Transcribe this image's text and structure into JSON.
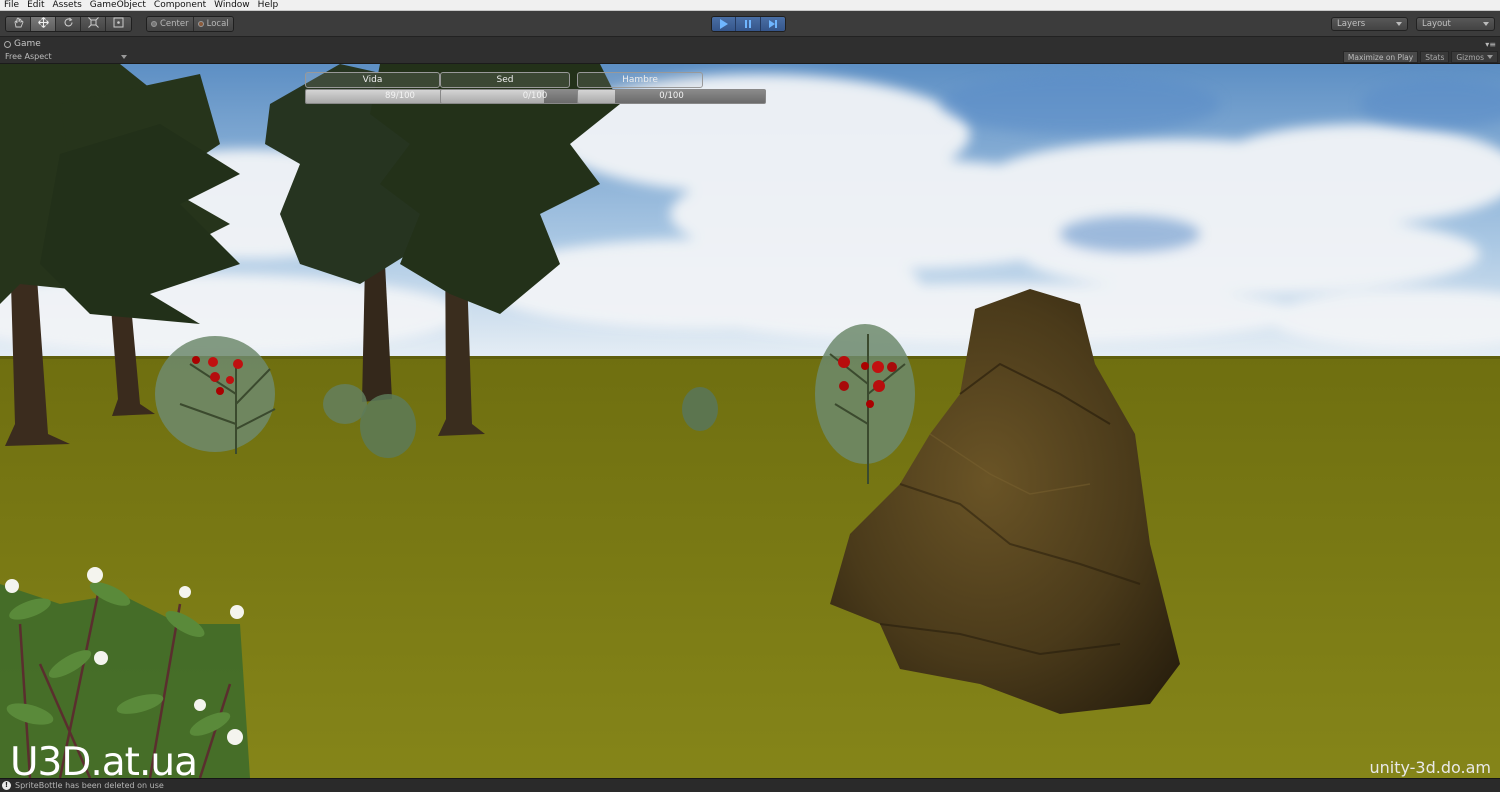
{
  "menu": [
    "File",
    "Edit",
    "Assets",
    "GameObject",
    "Component",
    "Window",
    "Help"
  ],
  "toolbar": {
    "tools": [
      "hand-icon",
      "move-icon",
      "rotate-icon",
      "scale-icon",
      "rect-icon"
    ],
    "pivot": "Center",
    "space": "Local",
    "layers": "Layers",
    "layout": "Layout"
  },
  "game_tab": {
    "title": "Game",
    "aspect": "Free Aspect",
    "maximize": "Maximize on Play",
    "stats": "Stats",
    "gizmos": "Gizmos"
  },
  "hud": {
    "vida_label": "Vida",
    "vida_value": "89/100",
    "vida_fraction": 0.89,
    "sed_label": "Sed",
    "sed_value": "0/100",
    "sed_fraction": 0.55,
    "hambre_label": "Hambre",
    "hambre_value": "0/100",
    "hambre_fraction": 0.2
  },
  "watermarks": {
    "left": "U3D.at.ua",
    "right": "unity-3d.do.am"
  },
  "status": {
    "message": "SpriteBottle has been deleted on use"
  },
  "colors": {
    "sky": "#9cbfe0",
    "ground": "#7a7a16",
    "rock": "#4a3a1c",
    "play_accent": "#4a6fa5"
  }
}
